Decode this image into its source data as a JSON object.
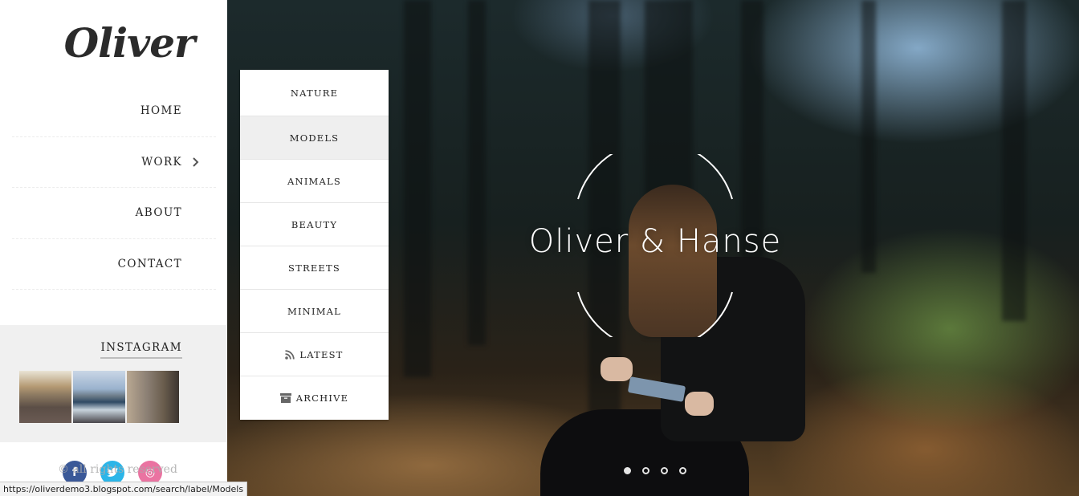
{
  "sidebar": {
    "logo": "Oliver",
    "nav": [
      {
        "label": "HOME",
        "has_submenu": false
      },
      {
        "label": "WORK",
        "has_submenu": true
      },
      {
        "label": "ABOUT",
        "has_submenu": false
      },
      {
        "label": "CONTACT",
        "has_submenu": false
      }
    ],
    "instagram": {
      "title": "INSTAGRAM",
      "thumbnails": [
        "cyclist-on-road",
        "bay-with-bridge",
        "street-with-bicycle"
      ]
    },
    "footer": {
      "copyright": "© all rights reserved",
      "social": [
        {
          "name": "facebook",
          "glyph": "f",
          "color": "#3b5998"
        },
        {
          "name": "twitter",
          "glyph": "t",
          "color": "#2bb5e8"
        },
        {
          "name": "dribbble",
          "glyph": "◎",
          "color": "#ea73a1"
        }
      ]
    }
  },
  "dropdown": {
    "items": [
      {
        "label": "NATURE",
        "icon": null,
        "hovered": false
      },
      {
        "label": "MODELS",
        "icon": null,
        "hovered": true
      },
      {
        "label": "ANIMALS",
        "icon": null,
        "hovered": false
      },
      {
        "label": "BEAUTY",
        "icon": null,
        "hovered": false
      },
      {
        "label": "STREETS",
        "icon": null,
        "hovered": false
      },
      {
        "label": "MINIMAL",
        "icon": null,
        "hovered": false
      },
      {
        "label": "LATEST",
        "icon": "rss-icon",
        "hovered": false
      },
      {
        "label": "ARCHIVE",
        "icon": "archive-icon",
        "hovered": false
      }
    ]
  },
  "hero": {
    "title": "Oliver & Hanse",
    "slides_total": 4,
    "active_slide": 1
  },
  "statusbar": {
    "url": "https://oliverdemo3.blogspot.com/search/label/Models"
  },
  "colors": {
    "text_dark": "#222222",
    "dropdown_hover": "#efefef",
    "instagram_bg": "#f0f0f0"
  }
}
